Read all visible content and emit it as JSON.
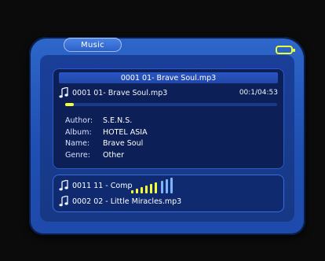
{
  "header": {
    "title": "Music"
  },
  "status": {
    "battery_icon": "battery-icon"
  },
  "now_playing": {
    "header": "0001 01- Brave Soul.mp3",
    "track_label": "0001 01- Brave Soul.mp3",
    "time": "00:1/04:53",
    "progress": 0.04,
    "fields": [
      {
        "label": "Author:",
        "value": "S.E.N.S."
      },
      {
        "label": "Album:",
        "value": "HOTEL ASIA"
      },
      {
        "label": "Name:",
        "value": "Brave Soul"
      },
      {
        "label": "Genre:",
        "value": "Other"
      }
    ]
  },
  "playlist": {
    "items": [
      {
        "label": "0011 11 - Comp"
      },
      {
        "label": "0002 02 - Little Miracles.mp3"
      }
    ]
  },
  "colors": {
    "accent": "#2d67c9",
    "progress_fill": "#f7ff3a",
    "battery": "#e6ff37"
  }
}
